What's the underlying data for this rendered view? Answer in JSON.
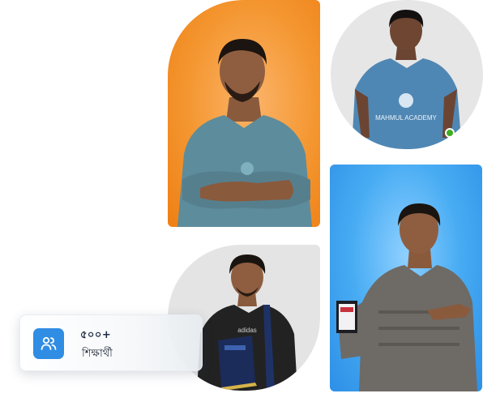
{
  "photos": [
    {
      "name": "student-photo-orange",
      "background": "#f49630",
      "shirt": "#5d8c9c"
    },
    {
      "name": "student-photo-round",
      "background": "#e6e6e6",
      "shirt": "#4f87b4",
      "shirt_print": "MAHMUL ACADEMY"
    },
    {
      "name": "student-photo-gray",
      "background": "#e4e4e4",
      "shirt": "#222222"
    },
    {
      "name": "student-photo-blue",
      "background": "#48acf3",
      "shirt": "#6e6a66"
    }
  ],
  "online_status": {
    "color": "#3fae1f"
  },
  "stat": {
    "icon": "users-icon",
    "value": "৫০০+",
    "label": "শিক্ষার্থী",
    "accent": "#2f8de4"
  }
}
